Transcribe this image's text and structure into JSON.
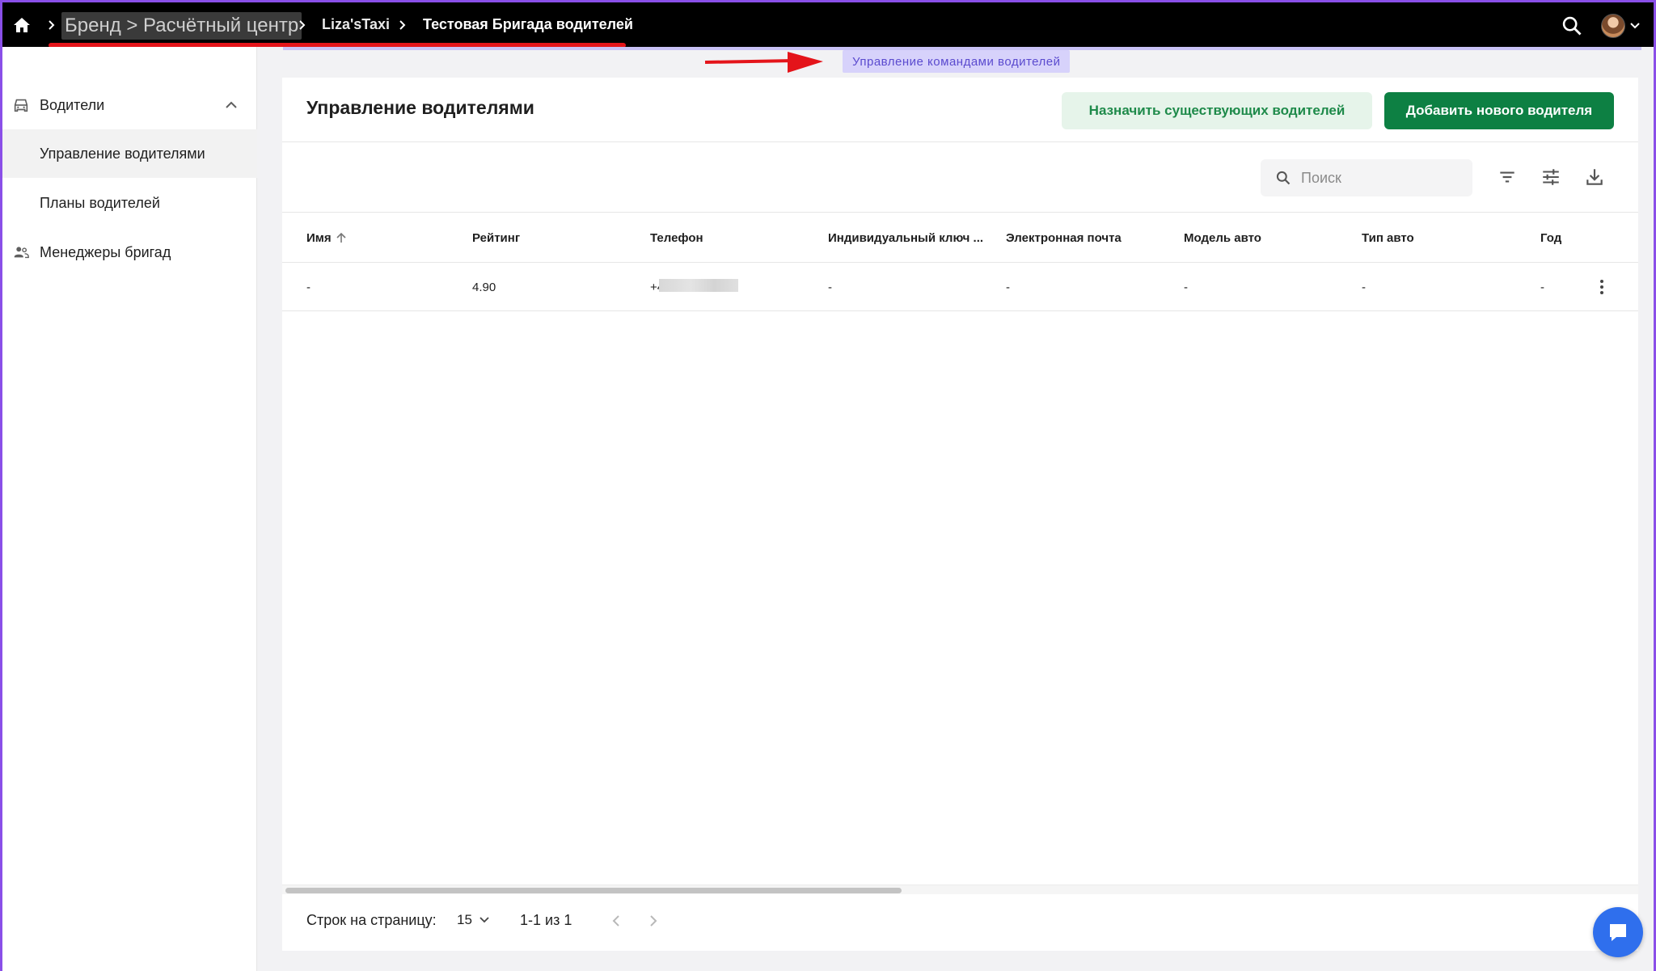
{
  "breadcrumb": {
    "brand": "Бренд > Расчётный центр",
    "company": "Liza'sTaxi",
    "current": "Тестовая Бригада водителей"
  },
  "tooltip": "Управление командами водителей",
  "sidebar": {
    "group_label": "Водители",
    "items": [
      {
        "label": "Управление водителями",
        "active": true
      },
      {
        "label": "Планы водителей",
        "active": false
      }
    ],
    "managers_label": "Менеджеры бригад"
  },
  "page": {
    "title": "Управление водителями",
    "assign_button": "Назначить существующих водителей",
    "add_button": "Добавить нового водителя"
  },
  "search": {
    "placeholder": "Поиск",
    "value": ""
  },
  "table": {
    "columns": [
      "Имя",
      "Рейтинг",
      "Телефон",
      "Индивидуальный ключ ...",
      "Электронная почта",
      "Модель авто",
      "Тип авто",
      "Год"
    ],
    "rows": [
      {
        "name": "-",
        "rating": "4.90",
        "phone": "+4",
        "key": "-",
        "email": "-",
        "model": "-",
        "type": "-",
        "year": "-"
      }
    ]
  },
  "footer": {
    "rows_per_page_label": "Строк на страницу:",
    "rows_per_page_value": "15",
    "range": "1-1 из 1"
  },
  "colors": {
    "accent_green": "#0d8043",
    "tooltip_bg": "#d7d2fb",
    "annotation_red": "#e4141a",
    "frame_purple": "#8a4fe8"
  }
}
